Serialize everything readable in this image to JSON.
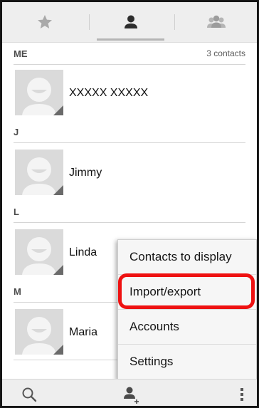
{
  "tabs": [
    {
      "icon": "star-icon"
    },
    {
      "icon": "person-icon",
      "selected": true
    },
    {
      "icon": "group-icon"
    }
  ],
  "list": {
    "group_label": "ME",
    "contact_count": "3 contacts",
    "sections": [
      {
        "letter": "",
        "contacts": [
          {
            "name": "XXXXX XXXXX"
          }
        ]
      },
      {
        "letter": "J",
        "contacts": [
          {
            "name": "Jimmy"
          }
        ]
      },
      {
        "letter": "L",
        "contacts": [
          {
            "name": "Linda"
          }
        ]
      },
      {
        "letter": "M",
        "contacts": [
          {
            "name": "Maria"
          }
        ]
      }
    ]
  },
  "menu": {
    "items": [
      {
        "label": "Contacts to display"
      },
      {
        "label": "Import/export",
        "highlighted": true
      },
      {
        "label": "Accounts"
      },
      {
        "label": "Settings"
      }
    ]
  },
  "bottom_bar": {
    "search_icon": "search-icon",
    "add_contact_icon": "add-contact-icon",
    "overflow_icon": "overflow-menu-icon"
  },
  "colors": {
    "highlight": "#ee1111",
    "bar_background": "#eeeeee",
    "icon_gray": "#9a9a9a"
  }
}
